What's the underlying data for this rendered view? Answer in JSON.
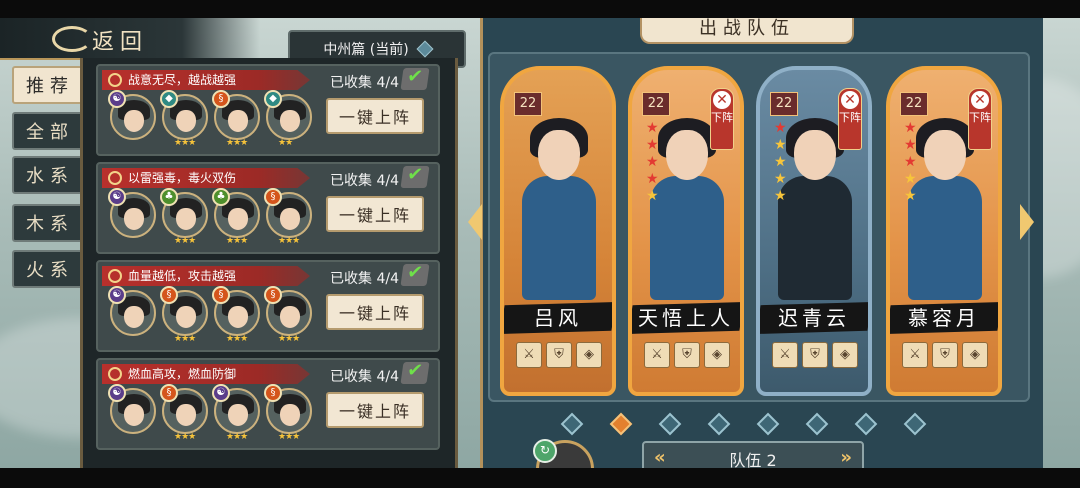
{
  "header": {
    "back_label": "返回",
    "chapter_label": "中州篇 (当前)"
  },
  "tabs": [
    {
      "label": "推荐",
      "active": true
    },
    {
      "label": "全部",
      "active": false
    },
    {
      "label": "水系",
      "active": false
    },
    {
      "label": "木系",
      "active": false
    },
    {
      "label": "火系",
      "active": false
    }
  ],
  "combos": [
    {
      "title": "战意无尽，越战越强",
      "collected": "已收集 4/4",
      "button": "一键上阵",
      "elements": [
        "dark",
        "water",
        "fire",
        "water"
      ]
    },
    {
      "title": "以雷强毒，毒火双伤",
      "collected": "已收集 4/4",
      "button": "一键上阵",
      "elements": [
        "dark",
        "wood",
        "wood",
        "fire"
      ]
    },
    {
      "title": "血量越低，攻击越强",
      "collected": "已收集 4/4",
      "button": "一键上阵",
      "elements": [
        "dark",
        "fire",
        "fire",
        "fire"
      ]
    },
    {
      "title": "燃血高攻，燃血防御",
      "collected": "已收集 4/4",
      "button": "一键上阵",
      "elements": [
        "dark",
        "fire",
        "dark",
        "fire"
      ]
    }
  ],
  "team": {
    "title": "出战队伍",
    "team_label": "队伍 2",
    "remove_label": "下阵",
    "page_count": 8,
    "active_page": 2,
    "cards": [
      {
        "name": "吕风",
        "level": "22",
        "removable": false,
        "red_stars": 0,
        "gold_stars": 0,
        "style": "orange"
      },
      {
        "name": "天悟上人",
        "level": "22",
        "removable": true,
        "red_stars": 4,
        "gold_stars": 1,
        "style": "orange2"
      },
      {
        "name": "迟青云",
        "level": "22",
        "removable": true,
        "red_stars": 1,
        "gold_stars": 4,
        "style": "blue"
      },
      {
        "name": "慕容月",
        "level": "22",
        "removable": true,
        "red_stars": 3,
        "gold_stars": 2,
        "style": "orange2"
      }
    ]
  },
  "colors": {
    "accent_gold": "#f0a640",
    "title_red": "#b8302c",
    "check_green": "#6fe04a"
  }
}
